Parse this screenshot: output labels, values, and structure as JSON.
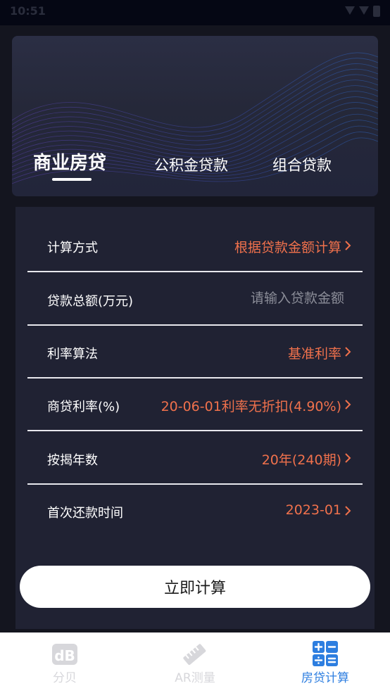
{
  "status_bar": {
    "time": "10:51"
  },
  "tabs": [
    {
      "label": "商业房贷",
      "active": true
    },
    {
      "label": "公积金贷款",
      "active": false
    },
    {
      "label": "组合贷款",
      "active": false
    }
  ],
  "form": {
    "calc_method": {
      "label": "计算方式",
      "value": "根据贷款金额计算"
    },
    "loan_total": {
      "label": "贷款总额(万元)",
      "placeholder": "请输入贷款金额"
    },
    "rate_method": {
      "label": "利率算法",
      "value": "基准利率"
    },
    "commercial_rate": {
      "label": "商贷利率(%)",
      "value": "20-06-01利率无折扣(4.90%)"
    },
    "loan_years": {
      "label": "按揭年数",
      "value": "20年(240期)"
    },
    "first_payment": {
      "label": "首次还款时间",
      "value": "2023-01"
    }
  },
  "calc_button": {
    "label": "立即计算"
  },
  "bottom_nav": [
    {
      "label": "分贝",
      "icon": "db-icon",
      "active": false
    },
    {
      "label": "AR测量",
      "icon": "ruler-icon",
      "active": false
    },
    {
      "label": "房贷计算",
      "icon": "calculator-icon",
      "active": true
    }
  ],
  "colors": {
    "accent": "#f0714c",
    "active_nav": "#2d7ee0",
    "background": "#14151f"
  }
}
